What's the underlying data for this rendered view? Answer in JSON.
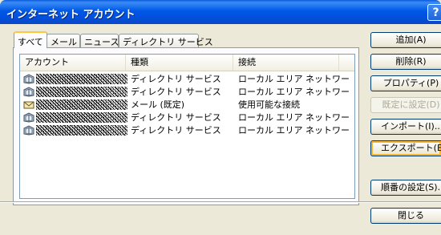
{
  "window": {
    "title": "インターネット アカウント",
    "help_label": "?"
  },
  "tabs": [
    "すべて",
    "メール",
    "ニュース",
    "ディレクトリ サービス"
  ],
  "columns": [
    "アカウント",
    "種類",
    "接続"
  ],
  "rows": [
    {
      "type": "ディレクトリ サービス",
      "connection": "ローカル エリア ネットワー..."
    },
    {
      "type": "ディレクトリ サービス",
      "connection": "ローカル エリア ネットワー..."
    },
    {
      "type": "メール (既定)",
      "connection": "使用可能な接続"
    },
    {
      "type": "ディレクトリ サービス",
      "connection": "ローカル エリア ネットワー..."
    },
    {
      "type": "ディレクトリ サービス",
      "connection": "ローカル エリア ネットワー..."
    }
  ],
  "buttons": {
    "add": "追加(A)",
    "remove": "削除(R)",
    "properties": "プロパティ(P)",
    "set_default": "既定に設定(D)",
    "import": "インポート(I)...",
    "export": "エクスポート(E)...",
    "set_order": "順番の設定(S)...",
    "close": "閉じる"
  }
}
